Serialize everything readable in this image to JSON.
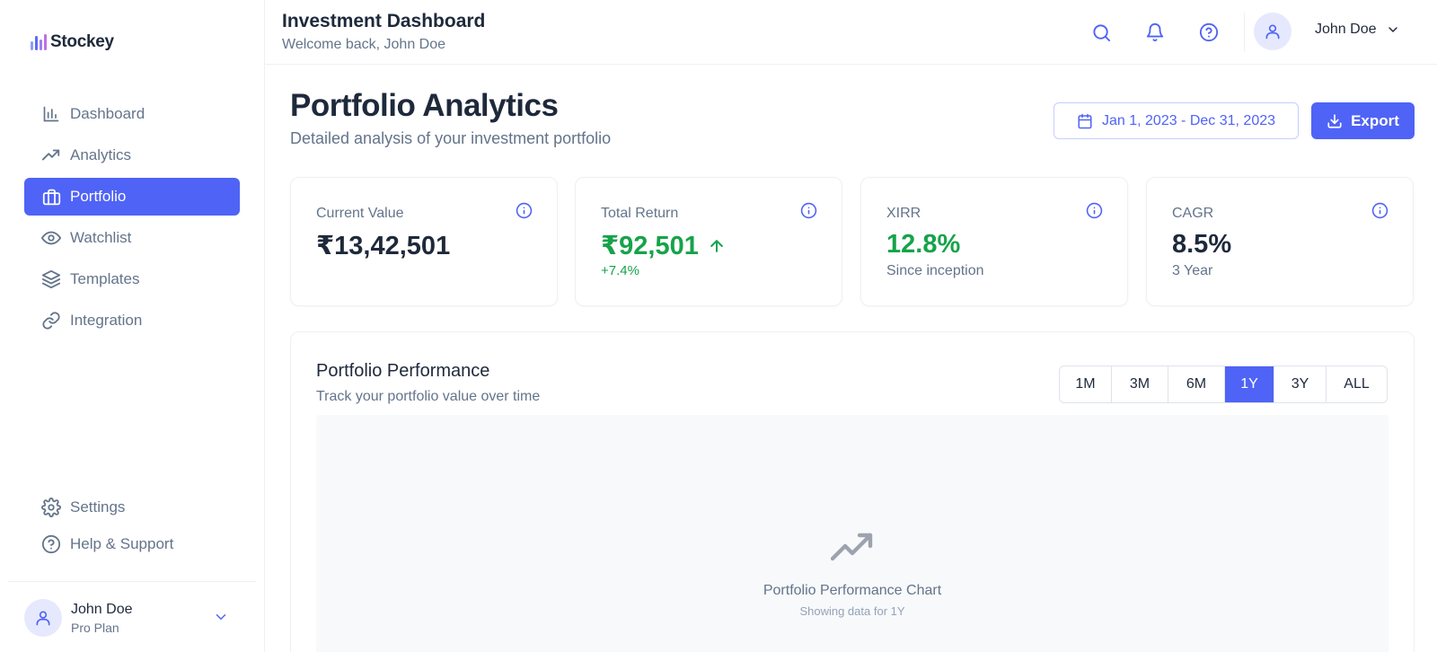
{
  "brand": {
    "name": "Stockey",
    "accent": "#4f63f6"
  },
  "sidebar": {
    "items": [
      {
        "label": "Dashboard",
        "icon": "bar-chart-icon"
      },
      {
        "label": "Analytics",
        "icon": "trending-up-icon"
      },
      {
        "label": "Portfolio",
        "icon": "briefcase-icon",
        "active": true
      },
      {
        "label": "Watchlist",
        "icon": "eye-icon"
      },
      {
        "label": "Templates",
        "icon": "layers-icon"
      },
      {
        "label": "Integration",
        "icon": "link-icon"
      }
    ],
    "bottom_items": [
      {
        "label": "Settings",
        "icon": "gear-icon"
      },
      {
        "label": "Help & Support",
        "icon": "help-circle-icon"
      }
    ],
    "user": {
      "name": "John Doe",
      "plan": "Pro Plan"
    }
  },
  "topbar": {
    "title": "Investment Dashboard",
    "subtitle": "Welcome back, John Doe",
    "user_name": "John Doe"
  },
  "main": {
    "title": "Portfolio Analytics",
    "subtitle": "Detailed analysis of your investment portfolio",
    "date_range": "Jan 1, 2023 - Dec 31, 2023",
    "export_label": "Export"
  },
  "stats": [
    {
      "label": "Current Value",
      "value": "₹13,42,501",
      "foot": ""
    },
    {
      "label": "Total Return",
      "value": "₹92,501",
      "foot": "+7.4%",
      "positive": true
    },
    {
      "label": "XIRR",
      "value": "12.8%",
      "foot": "Since inception",
      "positive": true
    },
    {
      "label": "CAGR",
      "value": "8.5%",
      "foot": "3 Year"
    }
  ],
  "performance": {
    "title": "Portfolio Performance",
    "subtitle": "Track your portfolio value over time",
    "ranges": [
      "1M",
      "3M",
      "6M",
      "1Y",
      "3Y",
      "ALL"
    ],
    "active_range": "1Y",
    "placeholder_title": "Portfolio Performance Chart",
    "placeholder_note": "Showing data for 1Y"
  }
}
